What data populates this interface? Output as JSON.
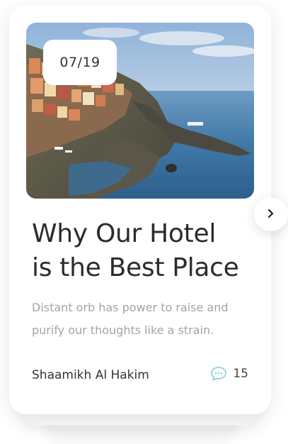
{
  "card": {
    "date": "07/19",
    "title_line1": "Why Our Hotel",
    "title_line2": "is the Best Place",
    "description": "Distant orb has power to raise and purify our thoughts like a strain.",
    "author": "Shaamikh Al Hakim",
    "comment_count": "15"
  },
  "icons": {
    "comment": "chat-bubble-icon",
    "next": "chevron-right-icon"
  },
  "colors": {
    "title": "#2b2b2b",
    "description": "#a3a3ab",
    "comment_icon": "#8fd0e0",
    "card_bg": "#ffffff"
  }
}
